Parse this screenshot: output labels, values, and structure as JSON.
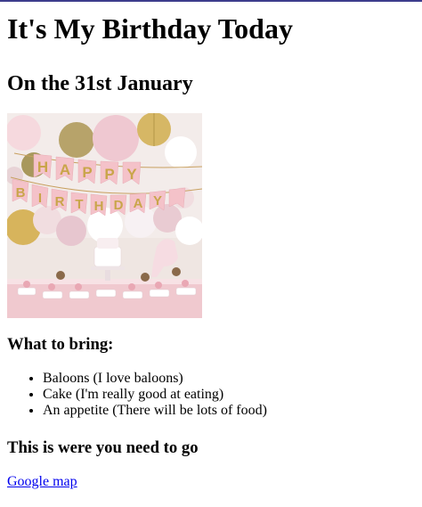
{
  "heading": "It's My Birthday Today",
  "date_line": "On the 31st January",
  "image": {
    "banner_letters": [
      "H",
      "A",
      "P",
      "P",
      "Y",
      "B",
      "I",
      "R",
      "T",
      "H",
      "D",
      "A",
      "Y"
    ]
  },
  "bring_heading": "What to bring:",
  "bring_items": [
    "Baloons (I love baloons)",
    "Cake (I'm really good at eating)",
    "An appetite (There will be lots of food)"
  ],
  "go_heading": "This is were you need to go",
  "map_link": "Google map",
  "colors": {
    "link": "#0000ee",
    "top_border": "#3c3c8c",
    "banner_pink": "#f4c2c9",
    "banner_gold": "#c9a54a"
  }
}
